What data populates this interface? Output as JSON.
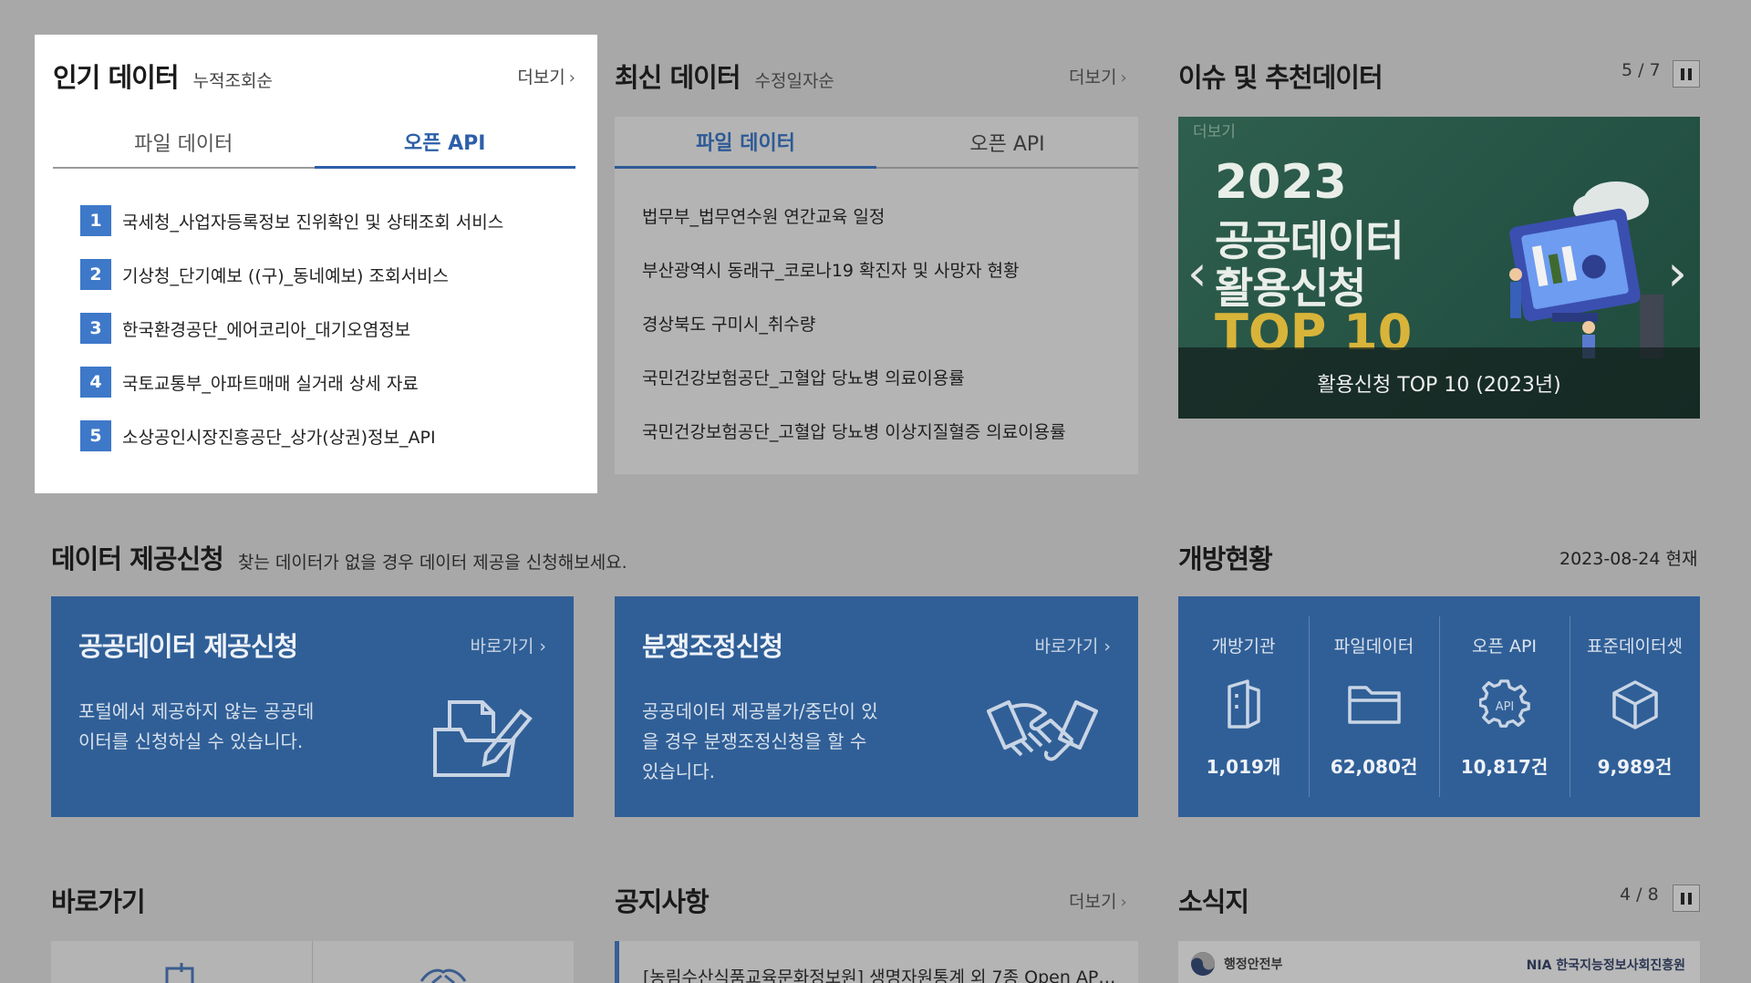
{
  "popular": {
    "title": "인기 데이터",
    "sort": "누적조회순",
    "more": "더보기",
    "tabs": [
      "파일 데이터",
      "오픈 API"
    ],
    "active_tab": 1,
    "items": [
      {
        "rank": "1",
        "text": "국세청_사업자등록정보 진위확인 및 상태조회 서비스"
      },
      {
        "rank": "2",
        "text": "기상청_단기예보 ((구)_동네예보) 조회서비스"
      },
      {
        "rank": "3",
        "text": "한국환경공단_에어코리아_대기오염정보"
      },
      {
        "rank": "4",
        "text": "국토교통부_아파트매매 실거래 상세 자료"
      },
      {
        "rank": "5",
        "text": "소상공인시장진흥공단_상가(상권)정보_API"
      }
    ]
  },
  "latest": {
    "title": "최신 데이터",
    "sort": "수정일자순",
    "more": "더보기",
    "tabs": [
      "파일 데이터",
      "오픈 API"
    ],
    "active_tab": 0,
    "items": [
      "법무부_법무연수원 연간교육 일정",
      "부산광역시 동래구_코로나19 확진자 및 사망자 현황",
      "경상북도 구미시_취수량",
      "국민건강보험공단_고혈압 당뇨병 의료이용률",
      "국민건강보험공단_고혈압 당뇨병 이상지질혈증 의료이용률"
    ]
  },
  "issues": {
    "title": "이슈 및 추천데이터",
    "counter": "5 / 7",
    "banner": {
      "more": "더보기",
      "year": "2023",
      "line1": "공공데이터",
      "line2": "활용신청",
      "line3": "TOP 10",
      "caption": "활용신청 TOP 10 (2023년)"
    }
  },
  "request": {
    "title": "데이터 제공신청",
    "subtitle": "찾는 데이터가 없을 경우 데이터 제공을 신청해보세요.",
    "cards": [
      {
        "title": "공공데이터 제공신청",
        "link": "바로가기",
        "desc": "포털에서 제공하지 않는 공공데이터를 신청하실 수 있습니다."
      },
      {
        "title": "분쟁조정신청",
        "link": "바로가기",
        "desc": "공공데이터 제공불가/중단이 있을 경우 분쟁조정신청을 할 수 있습니다."
      }
    ]
  },
  "status": {
    "title": "개방현황",
    "date": "2023-08-24 현재",
    "stats": [
      {
        "label": "개방기관",
        "value": "1,019개",
        "icon": "building-icon"
      },
      {
        "label": "파일데이터",
        "value": "62,080건",
        "icon": "folder-icon"
      },
      {
        "label": "오픈 API",
        "value": "10,817건",
        "icon": "api-gear-icon"
      },
      {
        "label": "표준데이터셋",
        "value": "9,989건",
        "icon": "cube-icon"
      }
    ]
  },
  "shortcuts": {
    "title": "바로가기"
  },
  "notices": {
    "title": "공지사항",
    "more": "더보기",
    "first": "[농림수산식품교육문화정보원] 생명자원통계 외 7종 Open AP…"
  },
  "news": {
    "title": "소식지",
    "counter": "4 / 8",
    "logo_left": "행정안전부",
    "logo_right": "NIA 한국지능정보사회진흥원"
  },
  "colors": {
    "accent": "#2d5fa8",
    "rank_badge": "#3e78c9",
    "card_blue": "#305f97",
    "overlay": "#a8a8a8"
  }
}
